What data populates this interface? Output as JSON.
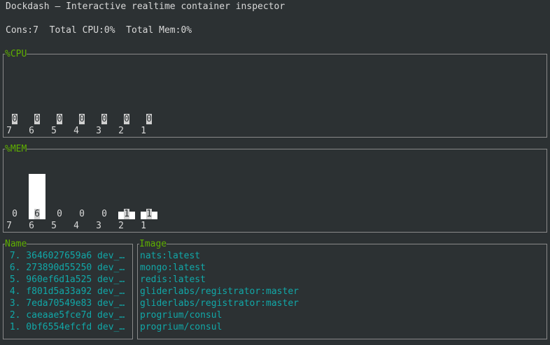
{
  "app": {
    "title": "Dockdash – Interactive realtime container inspector",
    "stats": "Cons:7  Total CPU:0%  Total Mem:0%"
  },
  "cpu": {
    "title": "%CPU",
    "bars": [
      {
        "label": "7",
        "value": 0
      },
      {
        "label": "6",
        "value": 0
      },
      {
        "label": "5",
        "value": 0
      },
      {
        "label": "4",
        "value": 0
      },
      {
        "label": "3",
        "value": 0
      },
      {
        "label": "2",
        "value": 0
      },
      {
        "label": "1",
        "value": 0
      }
    ]
  },
  "mem": {
    "title": "%MEM",
    "bars": [
      {
        "label": "7",
        "value": 0
      },
      {
        "label": "6",
        "value": 6
      },
      {
        "label": "5",
        "value": 0
      },
      {
        "label": "4",
        "value": 0
      },
      {
        "label": "3",
        "value": 0
      },
      {
        "label": "2",
        "value": 1
      },
      {
        "label": "1",
        "value": 1
      }
    ]
  },
  "names": {
    "title": "Name",
    "items": [
      " 7. 3646027659a6 dev_…",
      " 6. 273890d55250 dev_…",
      " 5. 960ef6d1a525 dev_…",
      " 4. f801d5a33a92 dev_…",
      " 3. 7eda70549e83 dev_…",
      " 2. caeaae5fce7d dev_…",
      " 1. 0bf6554efcfd dev_…"
    ]
  },
  "images": {
    "title": "Image",
    "items": [
      "nats:latest",
      "mongo:latest",
      "redis:latest",
      "gliderlabs/registrator:master",
      "gliderlabs/registrator:master",
      "progrium/consul",
      "progrium/consul"
    ]
  }
}
